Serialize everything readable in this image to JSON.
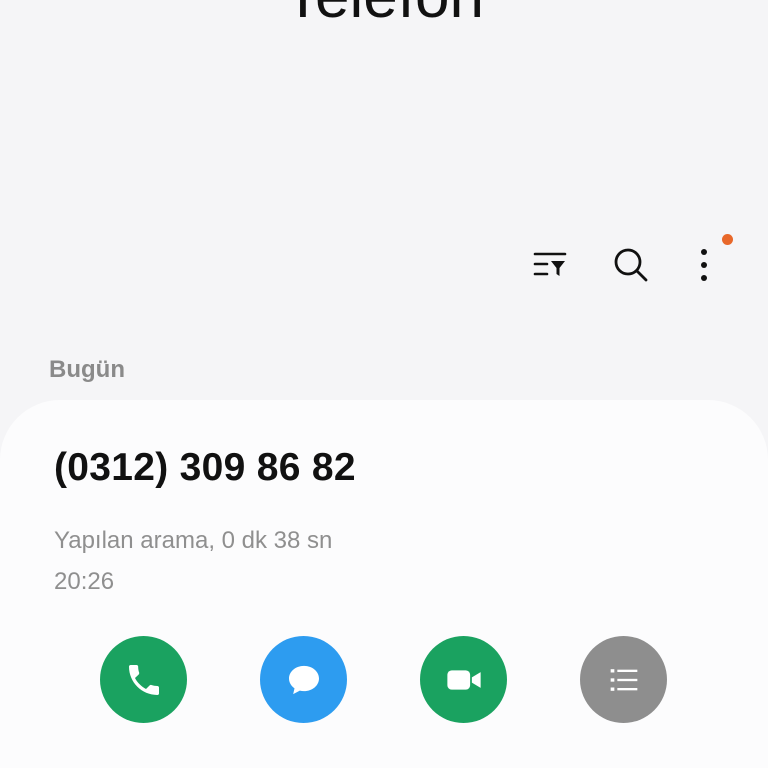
{
  "app": {
    "title": "Telefon"
  },
  "toolbar": {
    "filter_icon": "filter-list-icon",
    "search_icon": "search-icon",
    "more_icon": "more-vertical-icon",
    "notification_dot_color": "#e8682a"
  },
  "call_log": {
    "section_header": "Bugün",
    "entries": [
      {
        "number": "(0312) 309 86 82",
        "detail": "Yapılan arama, 0 dk 38 sn",
        "time": "20:26",
        "actions": [
          {
            "name": "call",
            "icon": "phone-icon",
            "color": "#1aa260"
          },
          {
            "name": "message",
            "icon": "message-bubble-icon",
            "color": "#2d9cf0"
          },
          {
            "name": "video",
            "icon": "video-camera-icon",
            "color": "#1aa260"
          },
          {
            "name": "details",
            "icon": "list-details-icon",
            "color": "#8e8e8e"
          }
        ]
      }
    ]
  }
}
